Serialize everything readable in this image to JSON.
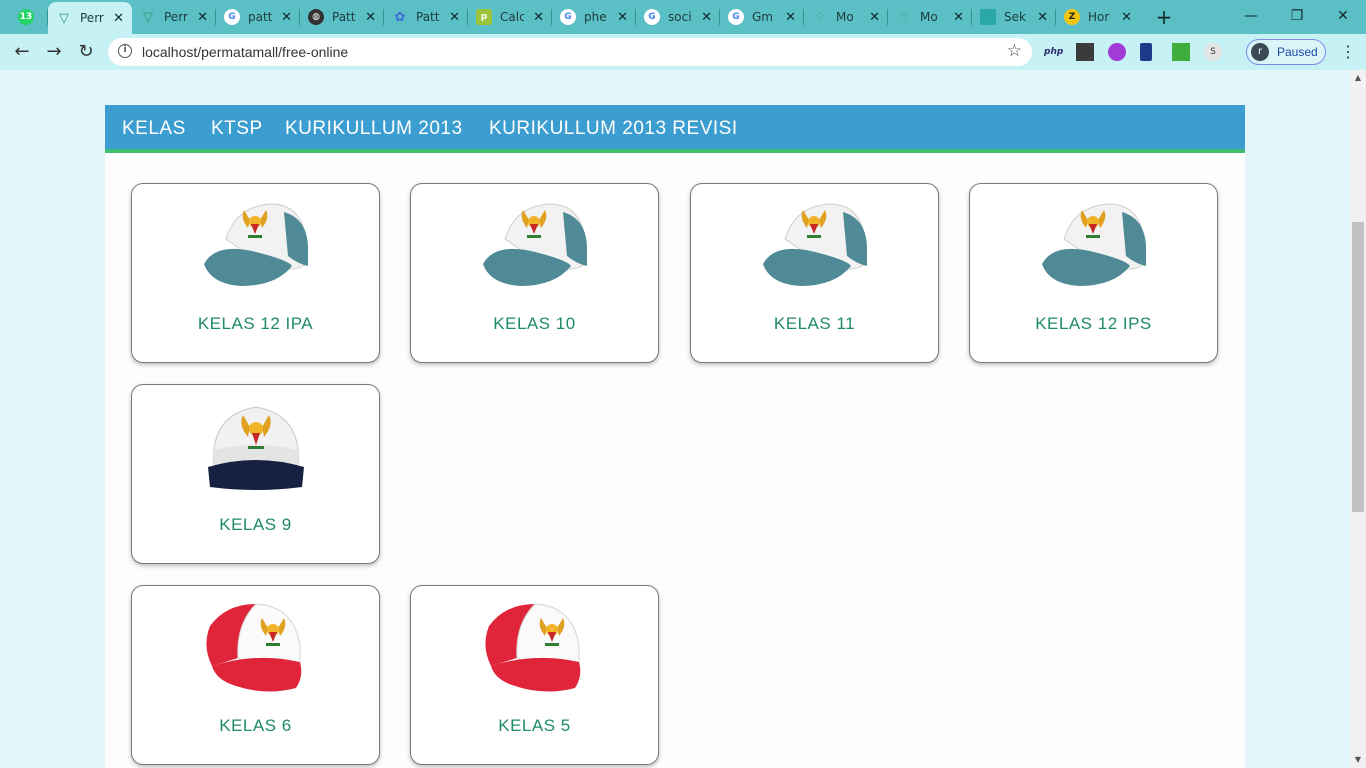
{
  "browser": {
    "tabs": [
      {
        "title": "",
        "badge": "13",
        "icon": "whatsapp-icon",
        "color": "#25d366"
      },
      {
        "title": "Perr",
        "icon": "vue-icon",
        "color": "#2e9b75"
      },
      {
        "title": "Perr",
        "icon": "vue-icon",
        "color": "#2e9b75"
      },
      {
        "title": "patt",
        "icon": "google-icon",
        "color": "#ffffff"
      },
      {
        "title": "Patt",
        "icon": "globe-icon",
        "color": "#333333"
      },
      {
        "title": "Patt",
        "icon": "puzzle-icon",
        "color": "#3b6bd6"
      },
      {
        "title": "Calc",
        "icon": "p-icon",
        "color": "#9cc43a"
      },
      {
        "title": "phe",
        "icon": "google-icon",
        "color": "#ffffff"
      },
      {
        "title": "soci",
        "icon": "google-icon",
        "color": "#ffffff"
      },
      {
        "title": "Gm",
        "icon": "google-icon",
        "color": "#ffffff"
      },
      {
        "title": "Mo",
        "icon": "dots-icon",
        "color": "#4a9b8a"
      },
      {
        "title": "Mo",
        "icon": "dots-icon",
        "color": "#4a9b8a"
      },
      {
        "title": "Sek",
        "icon": "folder-icon",
        "color": "#2aa8a8"
      },
      {
        "title": "Hor",
        "icon": "z-icon",
        "color": "#f1c40f"
      }
    ],
    "new_tab": "+",
    "window_controls": {
      "minimize": "—",
      "restore": "❐",
      "close": "✕"
    },
    "address": "localhost/permatamall/free-online",
    "extensions": [
      "php",
      "",
      "",
      "",
      "",
      "S"
    ],
    "profile": {
      "initial": "r",
      "status": "Paused"
    }
  },
  "navbar": {
    "links": [
      "KELAS",
      "KTSP",
      "KURIKULLUM 2013",
      "KURIKULLUM 2013 REVISI"
    ]
  },
  "cards": [
    {
      "label": "KELAS 12 IPA",
      "cap": "sma"
    },
    {
      "label": "KELAS 10",
      "cap": "sma"
    },
    {
      "label": "KELAS 11",
      "cap": "sma"
    },
    {
      "label": "KELAS 12 IPS",
      "cap": "sma"
    },
    {
      "label": "KELAS 9",
      "cap": "smp"
    },
    {
      "label": "KELAS 6",
      "cap": "sd"
    },
    {
      "label": "KELAS 5",
      "cap": "sd"
    }
  ],
  "colors": {
    "tabstrip": "#5bc0c5",
    "toolbar": "#c7f2f5",
    "navbar": "#3c9dd1",
    "navbar_border": "#3fbf6f",
    "card_label": "#1f8a6b",
    "cap_sma": "#4f8a96",
    "cap_smp": "#162040",
    "cap_sd": "#e0253a"
  }
}
